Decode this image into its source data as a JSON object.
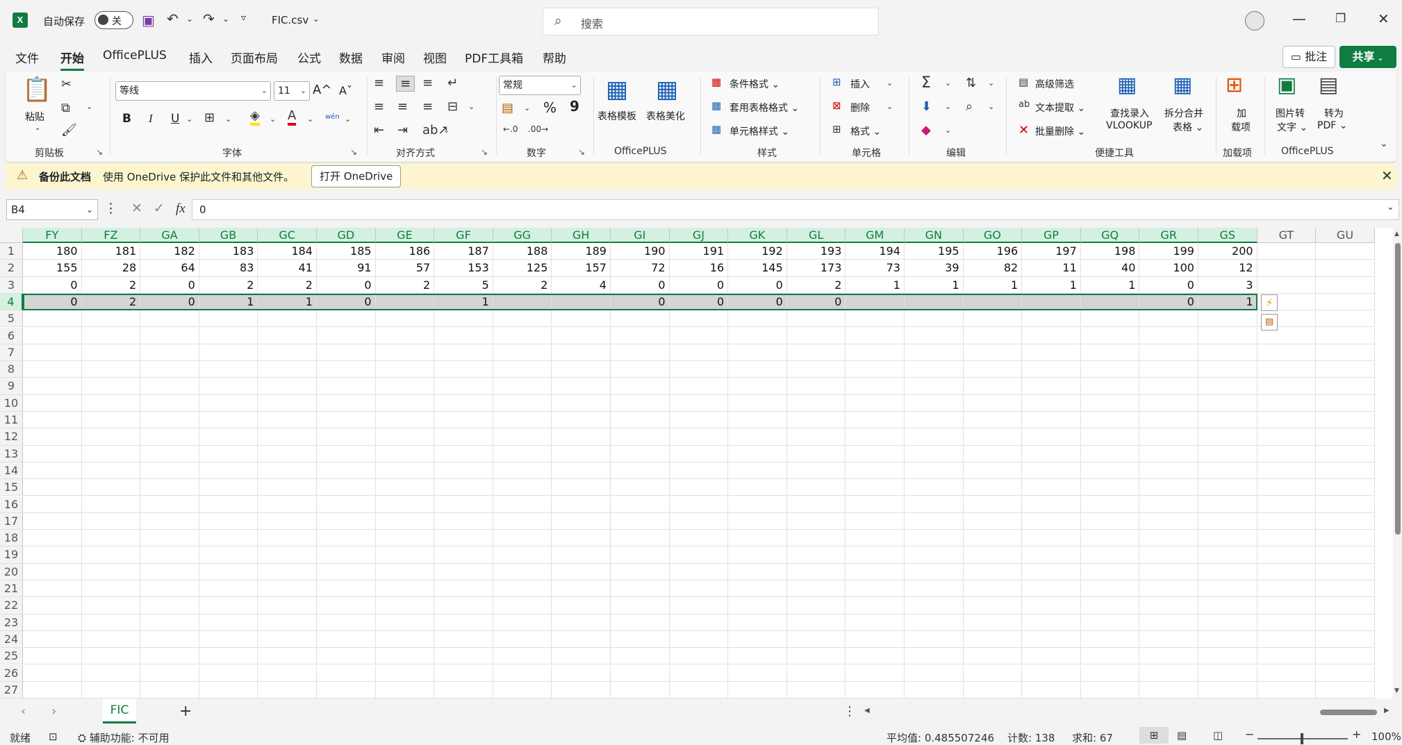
{
  "titlebar": {
    "autosave_label": "自动保存",
    "autosave_state": "关",
    "filename": "FIC.csv",
    "search_placeholder": "搜索"
  },
  "menu": {
    "items": [
      "文件",
      "开始",
      "OfficePLUS",
      "插入",
      "页面布局",
      "公式",
      "数据",
      "审阅",
      "视图",
      "PDF工具箱",
      "帮助"
    ],
    "active": "开始",
    "comment_label": "批注",
    "share_label": "共享"
  },
  "ribbon": {
    "clipboard": {
      "paste": "粘贴",
      "label": "剪贴板"
    },
    "font": {
      "name": "等线",
      "size": "11",
      "label": "字体",
      "bold": "B",
      "italic": "I",
      "underline": "U",
      "grow": "A^",
      "shrink": "Aˇ",
      "wen": "wén"
    },
    "alignment": {
      "label": "对齐方式"
    },
    "number": {
      "format": "常规",
      "label": "数字",
      "percent": "%",
      "comma": "9"
    },
    "officeplus": {
      "template": "表格模板",
      "beautify": "表格美化",
      "label": "OfficePLUS"
    },
    "styles": {
      "conditional": "条件格式",
      "table_format": "套用表格格式",
      "cell_styles": "单元格样式",
      "label": "样式"
    },
    "cells": {
      "insert": "插入",
      "delete": "删除",
      "format": "格式",
      "label": "单元格"
    },
    "editing": {
      "label": "编辑"
    },
    "tools": {
      "advanced_filter": "高级筛选",
      "text_extract": "文本提取",
      "batch_delete": "批量删除",
      "lookup_line1": "查找录入",
      "lookup_line2": "VLOOKUP",
      "split_line1": "拆分合并",
      "split_line2": "表格",
      "label": "便捷工具"
    },
    "addins": {
      "line1": "加",
      "line2": "载项",
      "label": "加载项"
    },
    "officeplus2": {
      "img_line1": "图片转",
      "img_line2": "文字",
      "pdf_line1": "转为",
      "pdf_line2": "PDF",
      "label": "OfficePLUS"
    }
  },
  "notification": {
    "title": "备份此文档",
    "message": "使用 OneDrive 保护此文件和其他文件。",
    "button": "打开 OneDrive"
  },
  "formula_bar": {
    "name_box": "B4",
    "fx": "fx",
    "value": "0"
  },
  "sheet": {
    "columns": [
      "FY",
      "FZ",
      "GA",
      "GB",
      "GC",
      "GD",
      "GE",
      "GF",
      "GG",
      "GH",
      "GI",
      "GJ",
      "GK",
      "GL",
      "GM",
      "GN",
      "GO",
      "GP",
      "GQ",
      "GR",
      "GS",
      "GT",
      "GU"
    ],
    "rows": [
      [
        "180",
        "181",
        "182",
        "183",
        "184",
        "185",
        "186",
        "187",
        "188",
        "189",
        "190",
        "191",
        "192",
        "193",
        "194",
        "195",
        "196",
        "197",
        "198",
        "199",
        "200",
        "",
        ""
      ],
      [
        "155",
        "28",
        "64",
        "83",
        "41",
        "91",
        "57",
        "153",
        "125",
        "157",
        "72",
        "16",
        "145",
        "173",
        "73",
        "39",
        "82",
        "11",
        "40",
        "100",
        "12",
        "",
        ""
      ],
      [
        "0",
        "2",
        "0",
        "2",
        "2",
        "0",
        "2",
        "5",
        "2",
        "4",
        "0",
        "0",
        "0",
        "2",
        "1",
        "1",
        "1",
        "1",
        "1",
        "0",
        "3",
        "",
        ""
      ],
      [
        "0",
        "2",
        "0",
        "1",
        "1",
        "0",
        "",
        "1",
        "",
        "",
        "0",
        "0",
        "0",
        "0",
        "",
        "",
        "",
        "",
        "",
        "0",
        "1",
        "",
        ""
      ]
    ],
    "row_count": 27,
    "selected_row": 4
  },
  "tabs": {
    "sheets": [
      "FIC"
    ],
    "add": "+"
  },
  "status": {
    "ready": "就绪",
    "accessibility": "辅助功能: 不可用",
    "average": "平均值: 0.485507246",
    "count": "计数: 138",
    "sum": "求和: 67",
    "zoom": "100%"
  }
}
